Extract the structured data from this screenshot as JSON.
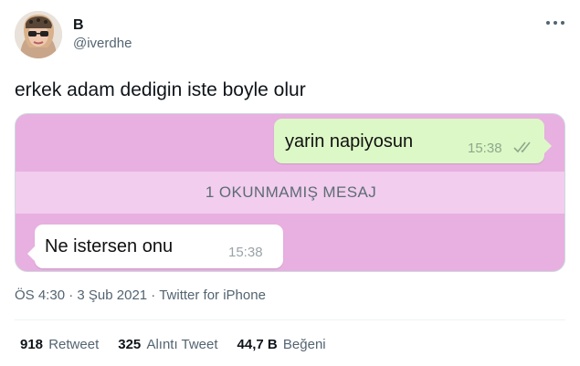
{
  "author": {
    "display_name": "B",
    "handle": "@iverdhe"
  },
  "tweet": {
    "text": "erkek adam dedigin iste boyle olur"
  },
  "chat": {
    "outgoing_message": "yarin napiyosun",
    "outgoing_time": "15:38",
    "outgoing_status_icon": "double-check-icon",
    "unread_banner": "1 OKUNMAMIŞ MESAJ",
    "incoming_message": "Ne istersen onu",
    "incoming_time": "15:38",
    "background_color": "#e7b0e0",
    "outgoing_bubble_color": "#dcf8c6"
  },
  "meta": {
    "time": "ÖS 4:30",
    "separator1": " · ",
    "date": "3 Şub 2021",
    "separator2": " · ",
    "source": "Twitter for iPhone"
  },
  "stats": [
    {
      "count": "918",
      "label": "Retweet"
    },
    {
      "count": "325",
      "label": "Alıntı Tweet"
    },
    {
      "count": "44,7 B",
      "label": "Beğeni"
    }
  ]
}
